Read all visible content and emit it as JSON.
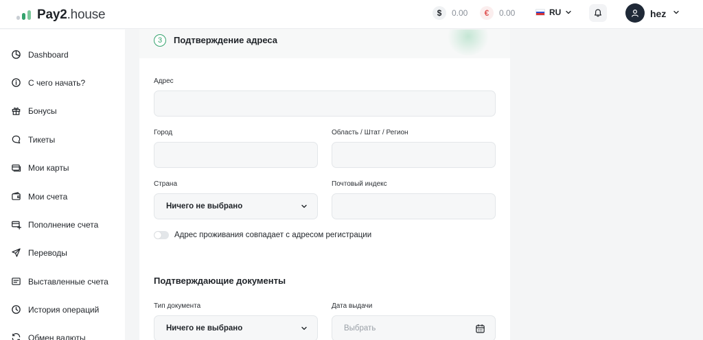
{
  "brand": {
    "name_bold": "Pay2",
    "name_light": ".house",
    "mark_colors": [
      "#c9ced4",
      "#34a36d",
      "#7bc79b"
    ]
  },
  "header": {
    "usd": {
      "symbol": "$",
      "amount": "0.00"
    },
    "eur": {
      "symbol": "€",
      "amount": "0.00"
    },
    "language": "RU",
    "username": "hez"
  },
  "sidebar": {
    "items": [
      {
        "label": "Dashboard",
        "icon": "pie-chart-icon"
      },
      {
        "label": "С чего начать?",
        "icon": "info-icon"
      },
      {
        "label": "Бонусы",
        "icon": "gift-icon"
      },
      {
        "label": "Тикеты",
        "icon": "chat-icon"
      },
      {
        "label": "Мои карты",
        "icon": "cards-icon"
      },
      {
        "label": "Мои счета",
        "icon": "wallet-icon"
      },
      {
        "label": "Пополнение счета",
        "icon": "card-plus-icon"
      },
      {
        "label": "Переводы",
        "icon": "send-icon"
      },
      {
        "label": "Выставленные счета",
        "icon": "invoice-icon"
      },
      {
        "label": "История операций",
        "icon": "clock-icon"
      },
      {
        "label": "Обмен валюты",
        "icon": "exchange-icon"
      }
    ]
  },
  "step": {
    "number": "3",
    "title": "Подтверждение адреса"
  },
  "form": {
    "address_label": "Адрес",
    "address_value": "",
    "city_label": "Город",
    "city_value": "",
    "region_label": "Область / Штат / Регион",
    "region_value": "",
    "country_label": "Страна",
    "country_value": "Ничего не выбрано",
    "zip_label": "Почтовый индекс",
    "zip_value": "",
    "same_address_label": "Адрес проживания совпадает с адресом регистрации",
    "same_address_checked": false
  },
  "documents": {
    "title": "Подтверждающие документы",
    "doc_type_label": "Тип документа",
    "doc_type_value": "Ничего не выбрано",
    "issue_date_label": "Дата выдачи",
    "issue_date_placeholder": "Выбрать"
  },
  "colors": {
    "accent": "#34a36d",
    "page_bg": "#f4f5f6",
    "field_bg": "#f6f7f8",
    "usd_icon": "#1f2328",
    "eur_icon": "#e05252"
  }
}
